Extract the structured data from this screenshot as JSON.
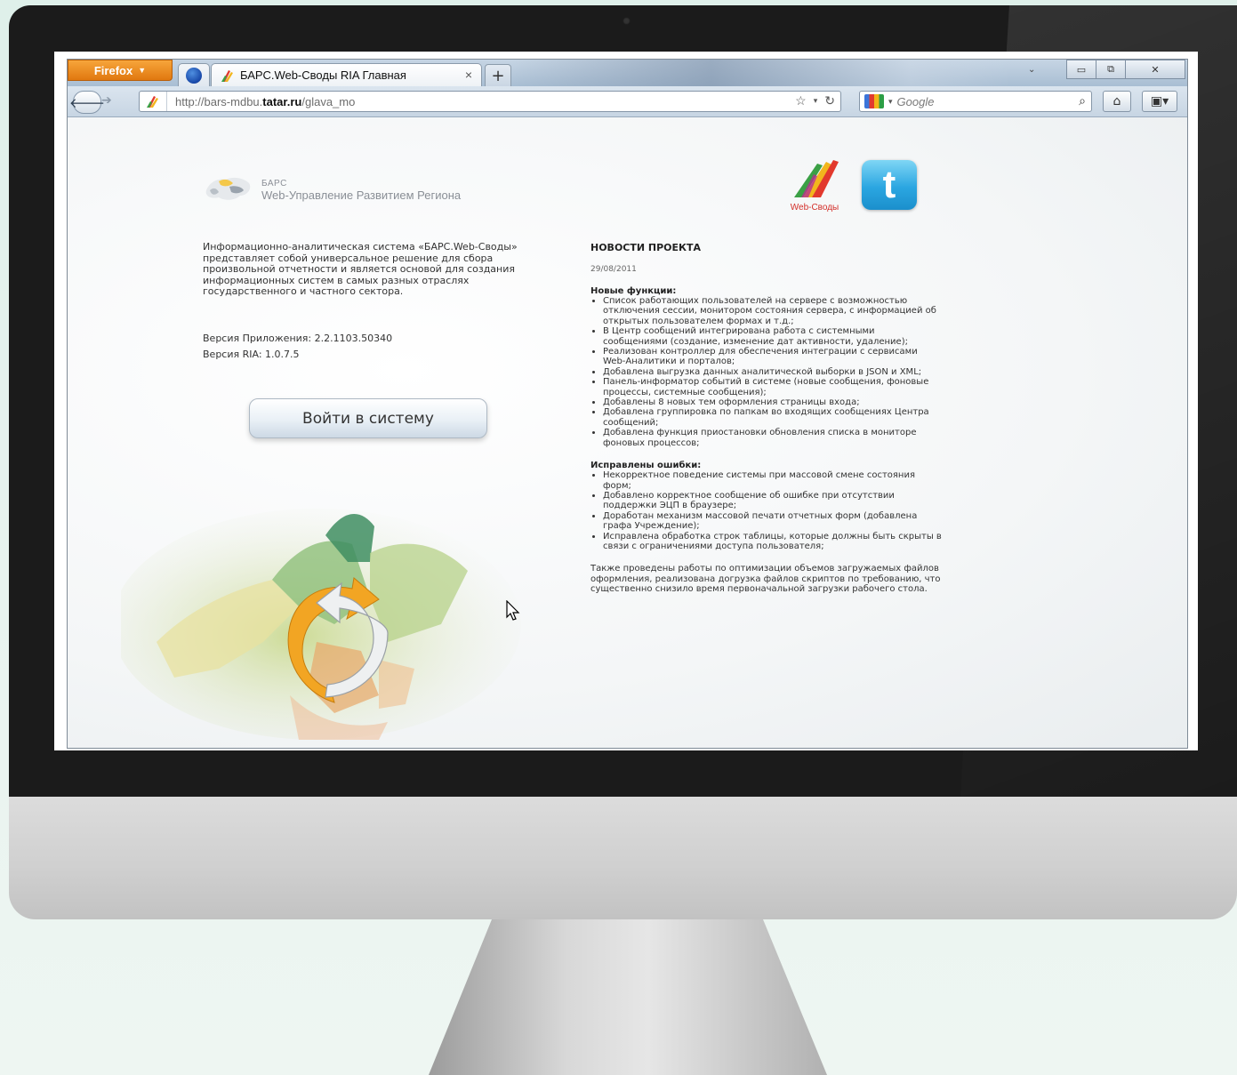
{
  "browser": {
    "firefox_button_label": "Firefox",
    "tab_title": "БАРС.Web-Своды RIA Главная",
    "tab_close": "×",
    "new_tab_label": "+",
    "tab_list_icon": "chevron-down-icon",
    "url_prefix": "http://bars-mdbu.",
    "url_domain": "tatar.ru",
    "url_path": "/glava_mo",
    "search_engine": "Google",
    "window_controls": [
      "minimize",
      "restore",
      "close"
    ]
  },
  "page": {
    "logo": {
      "line1": "БАРС",
      "line2": "Web-Управление Развитием Региона"
    },
    "intro_text": "Информационно-аналитическая система «БАРС.Web-Своды» представляет собой универсальное решение для сбора произвольной отчетности и является основой для создания информационных систем в самых разных отраслях государственного и частного сектора.",
    "app_version": "Версия Приложения: 2.2.1103.50340",
    "ria_version": "Версия RIA: 1.0.7.5",
    "login_button": "Войти в систему",
    "webs_logo_text": "Web-Своды",
    "twitter_glyph": "t",
    "news": {
      "heading": "НОВОСТИ ПРОЕКТА",
      "date": "29/08/2011",
      "features_heading": "Новые функции:",
      "features": [
        "Список работающих пользователей на сервере с возможностью отключения сессии, монитором состояния сервера, с информацией об открытых пользователем формах и т.д.;",
        "В Центр сообщений интегрирована работа с системными сообщениями (создание, изменение дат активности, удаление);",
        "Реализован контроллер для обеспечения интеграции с сервисами Web-Аналитики и порталов;",
        "Добавлена выгрузка данных аналитической выборки в JSON и XML;",
        "Панель-информатор событий в системе (новые сообщения, фоновые процессы, системные сообщения);",
        "Добавлены 8 новых тем оформления страницы входа;",
        "Добавлена группировка по папкам во входящих сообщениях Центра сообщений;",
        "Добавлена функция приостановки обновления списка в мониторе фоновых процессов;"
      ],
      "fixes_heading": "Исправлены ошибки:",
      "fixes": [
        "Некорректное поведение системы при массовой смене состояния форм;",
        "Добавлено корректное сообщение об ошибке при отсутствии поддержки ЭЦП в браузере;",
        "Доработан механизм массовой печати отчетных форм (добавлена графа Учреждение);",
        "Исправлена обработка строк таблицы, которые должны быть скрыты в связи с ограничениями доступа пользователя;"
      ],
      "closing_note": "Также проведены работы по оптимизации объемов загружаемых файлов оформления, реализована догрузка файлов скриптов по требованию, что существенно снизило время первоначальной загрузки рабочего стола."
    }
  }
}
